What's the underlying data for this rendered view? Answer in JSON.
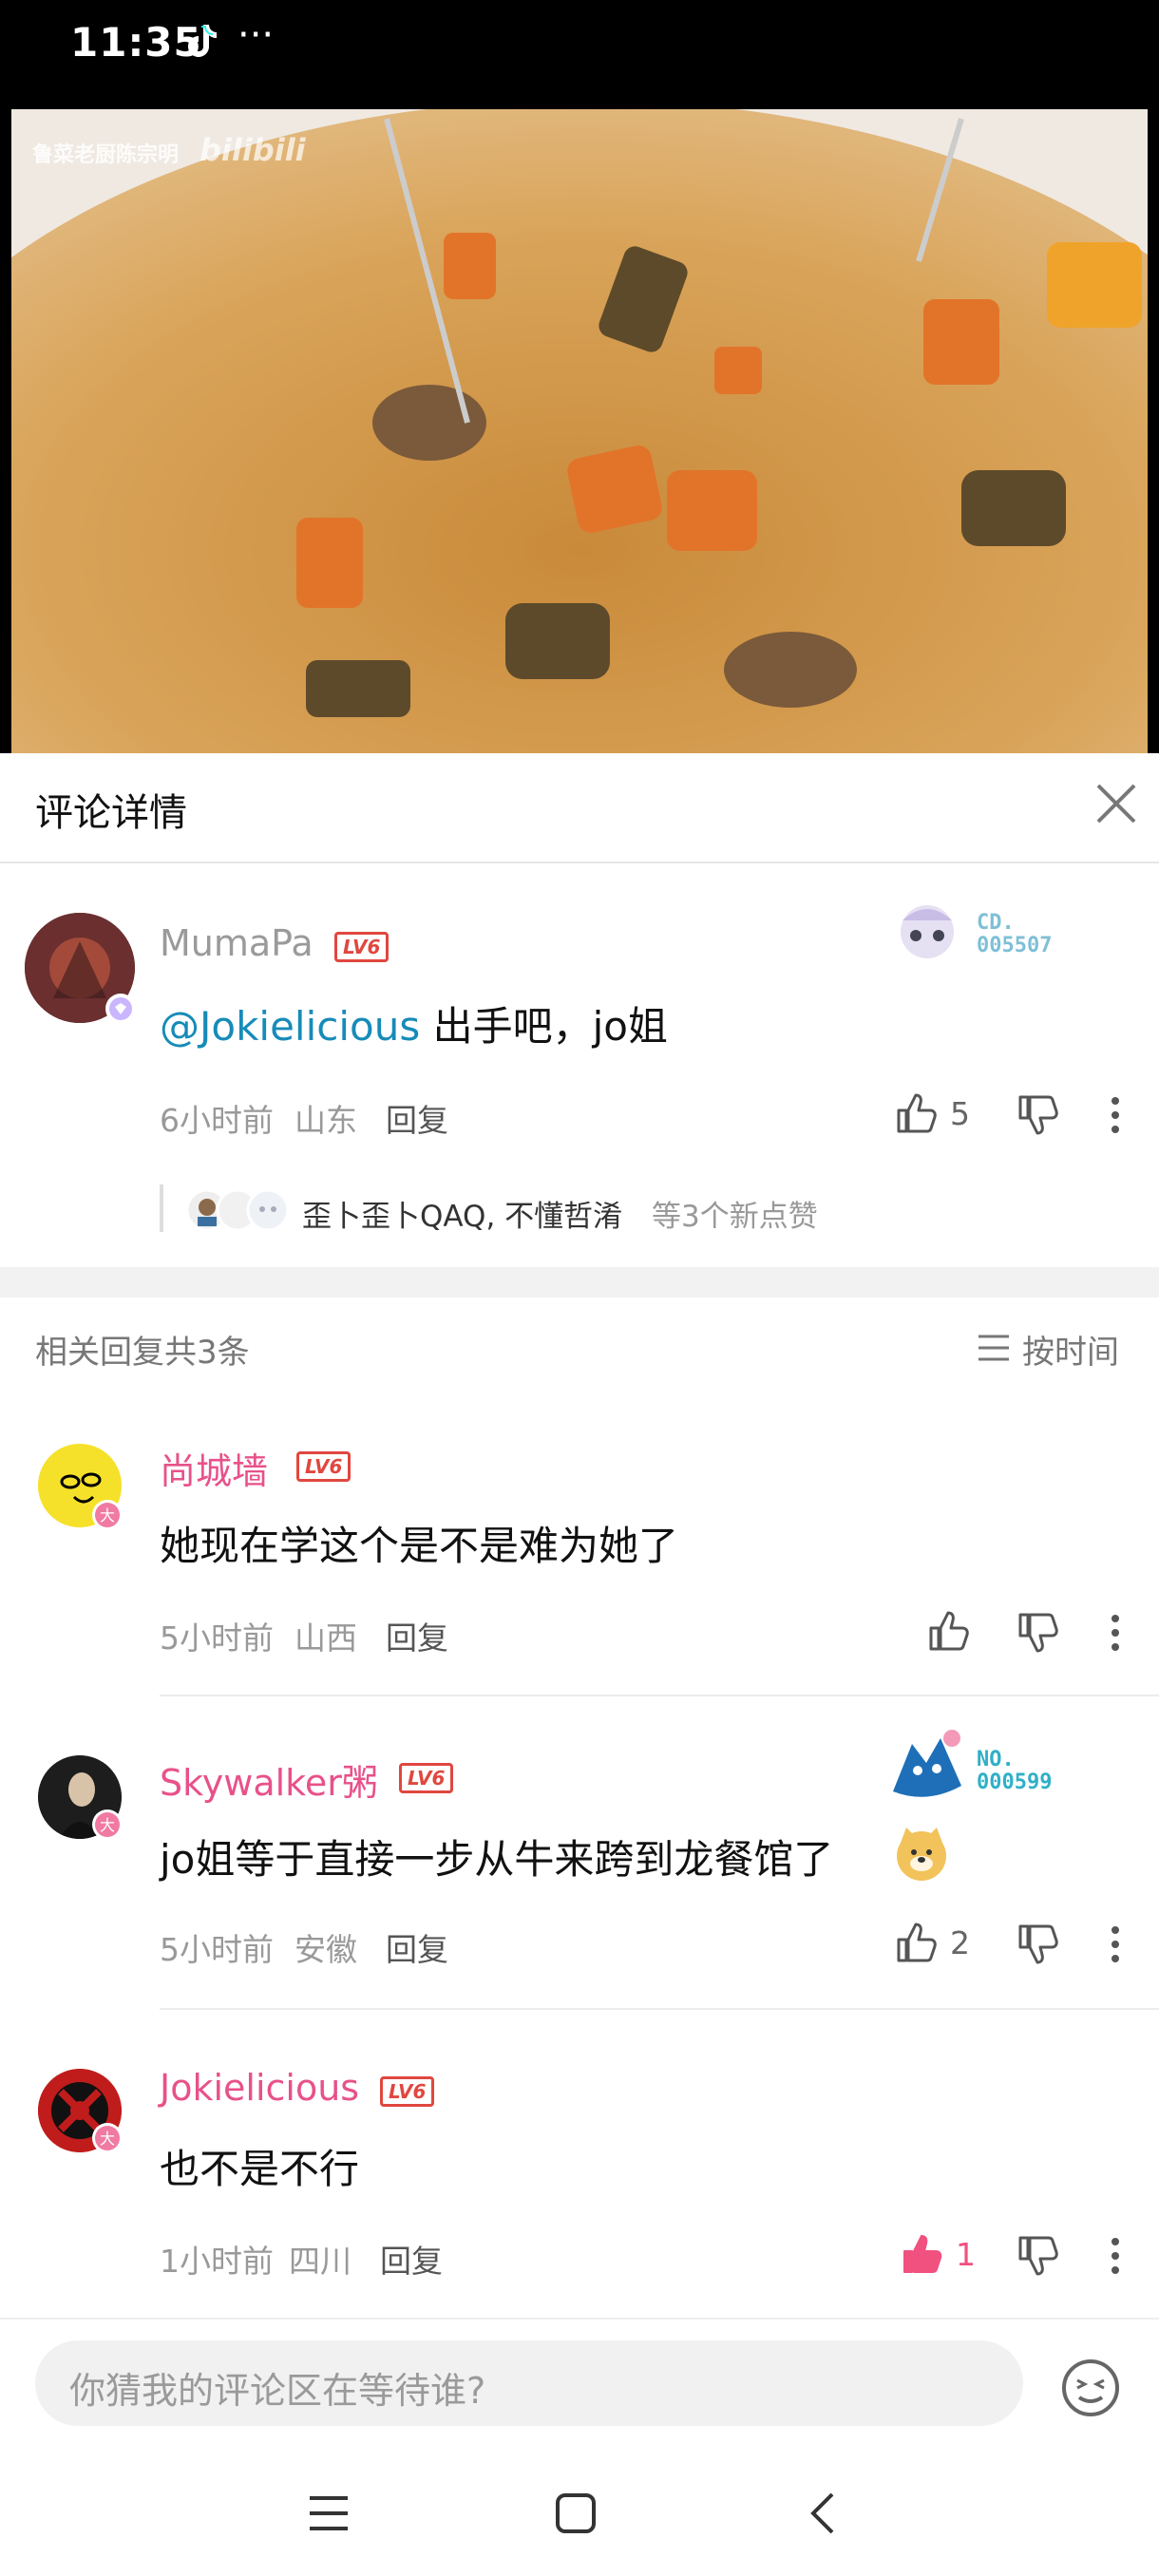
{
  "status_bar": {
    "time": "11:35",
    "more": "···"
  },
  "video": {
    "watermark_text": "鲁菜老厨陈宗明",
    "watermark_logo": "bilibili"
  },
  "panel": {
    "title": "评论详情"
  },
  "main_comment": {
    "username": "MumaPa",
    "level": "LV6",
    "mention": "@Jokielicious",
    "text": " 出手吧，jo姐",
    "fan_label": "CD.",
    "fan_number": "005507",
    "time": "6小时前",
    "location": "山东",
    "reply_label": "回复",
    "likes": "5",
    "likers_names": "歪卜歪卜QAQ, 不懂哲淆",
    "likers_suffix": "等3个新点赞"
  },
  "replies_header": {
    "count_label": "相关回复共3条",
    "sort_label": "按时间"
  },
  "replies": [
    {
      "username": "尚城墙",
      "level": "LV6",
      "text": "她现在学这个是不是难为她了",
      "time": "5小时前",
      "location": "山西",
      "reply_label": "回复",
      "likes": ""
    },
    {
      "username": "Skywalker粥",
      "level": "LV6",
      "text": "jo姐等于直接一步从牛来跨到龙餐馆了",
      "fan_label": "NO.",
      "fan_number": "000599",
      "time": "5小时前",
      "location": "安徽",
      "reply_label": "回复",
      "likes": "2"
    },
    {
      "username": "Jokielicious",
      "level": "LV6",
      "text": "也不是不行",
      "time": "1小时前",
      "location": "四川",
      "reply_label": "回复",
      "likes": "1"
    }
  ],
  "input": {
    "placeholder": "你猜我的评论区在等待谁?"
  },
  "colors": {
    "pink_name": "#e8518a",
    "gray_name": "#9a9a9a",
    "mention_blue": "#178bb8",
    "level_red": "#e0473f",
    "liked_pink": "#f0517f"
  }
}
